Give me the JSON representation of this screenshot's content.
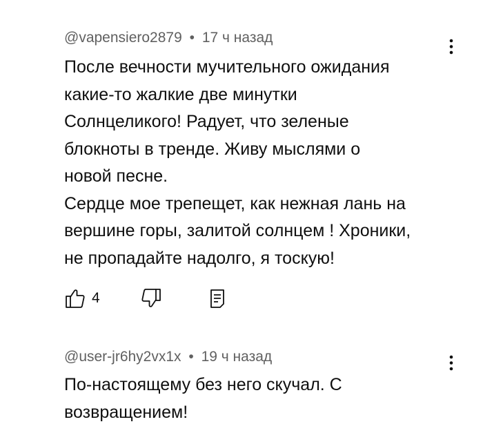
{
  "comments": [
    {
      "author": "@vapensiero2879",
      "separator": "•",
      "time": "17 ч назад",
      "text": "После вечности мучительного ожидания\nкакие-то жалкие две минутки\nСолнцеликого! Радует, что зеленые\nблокноты в тренде. Живу мыслями о\nновой песне.\nСердце мое трепещет, как нежная лань на\nвершине горы, залитой солнцем ! Хроники,\nне пропадайте надолго, я тоскую!",
      "likes": "4"
    },
    {
      "author": "@user-jr6hy2vx1x",
      "separator": "•",
      "time": "19 ч назад",
      "text": "По-настоящему без него скучал.  С\nвозвращением!"
    }
  ],
  "icons": {
    "like": "thumb-up-icon",
    "dislike": "thumb-down-icon",
    "reply": "reply-comment-icon",
    "more": "more-vertical-icon"
  },
  "colors": {
    "text": "#0f0f0f",
    "meta": "#606060",
    "background": "#ffffff"
  }
}
